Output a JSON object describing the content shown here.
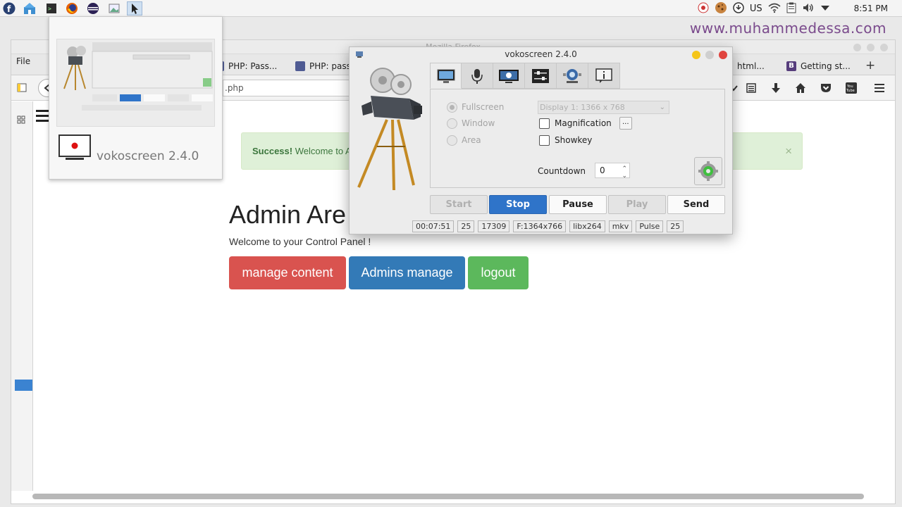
{
  "system_panel": {
    "keyboard_layout": "US",
    "clock": "8:51 PM"
  },
  "watermark": "www.muhammedessa.com",
  "preview": {
    "app_title": "vokoscreen 2.4.0"
  },
  "firefox": {
    "window_title": "Mozilla Firefox",
    "menu_file": "File",
    "tabs": [
      {
        "label": "PHP: Pass...",
        "favicon_color": "#4f5b93"
      },
      {
        "label": "PHP: pass",
        "favicon_color": "#4f5b93"
      },
      {
        "label": "html...",
        "favicon_color": "#cccccc"
      },
      {
        "label": "Getting st...",
        "favicon_color": "#563d7c",
        "favicon_letter": "B"
      }
    ],
    "new_tab": "+",
    "url": ".php",
    "page": {
      "alert_strong": "Success!",
      "alert_text": "Welcome to A",
      "alert_close": "×",
      "title": "Admin Are",
      "welcome": "Welcome to your Control Panel !",
      "buttons": {
        "manage_content": "manage content",
        "admins_manage": "Admins manage",
        "logout": "logout"
      }
    }
  },
  "vokoscreen": {
    "title": "vokoscreen 2.4.0",
    "tabs": [
      "screen-tab",
      "audio-tab",
      "video-tab",
      "settings-tab",
      "webcam-tab",
      "info-tab"
    ],
    "modes": [
      "Fullscreen",
      "Window",
      "Area"
    ],
    "display_select": "Display 1:  1366 x 768",
    "magnification": "Magnification",
    "magnification_dots": "...",
    "showkey": "Showkey",
    "countdown_label": "Countdown",
    "countdown_value": "0",
    "buttons": {
      "start": "Start",
      "stop": "Stop",
      "pause": "Pause",
      "play": "Play",
      "send": "Send"
    },
    "status": [
      "00:07:51",
      "25",
      "17309",
      "F:1364x766",
      "libx264",
      "mkv",
      "Pulse",
      "25"
    ]
  }
}
